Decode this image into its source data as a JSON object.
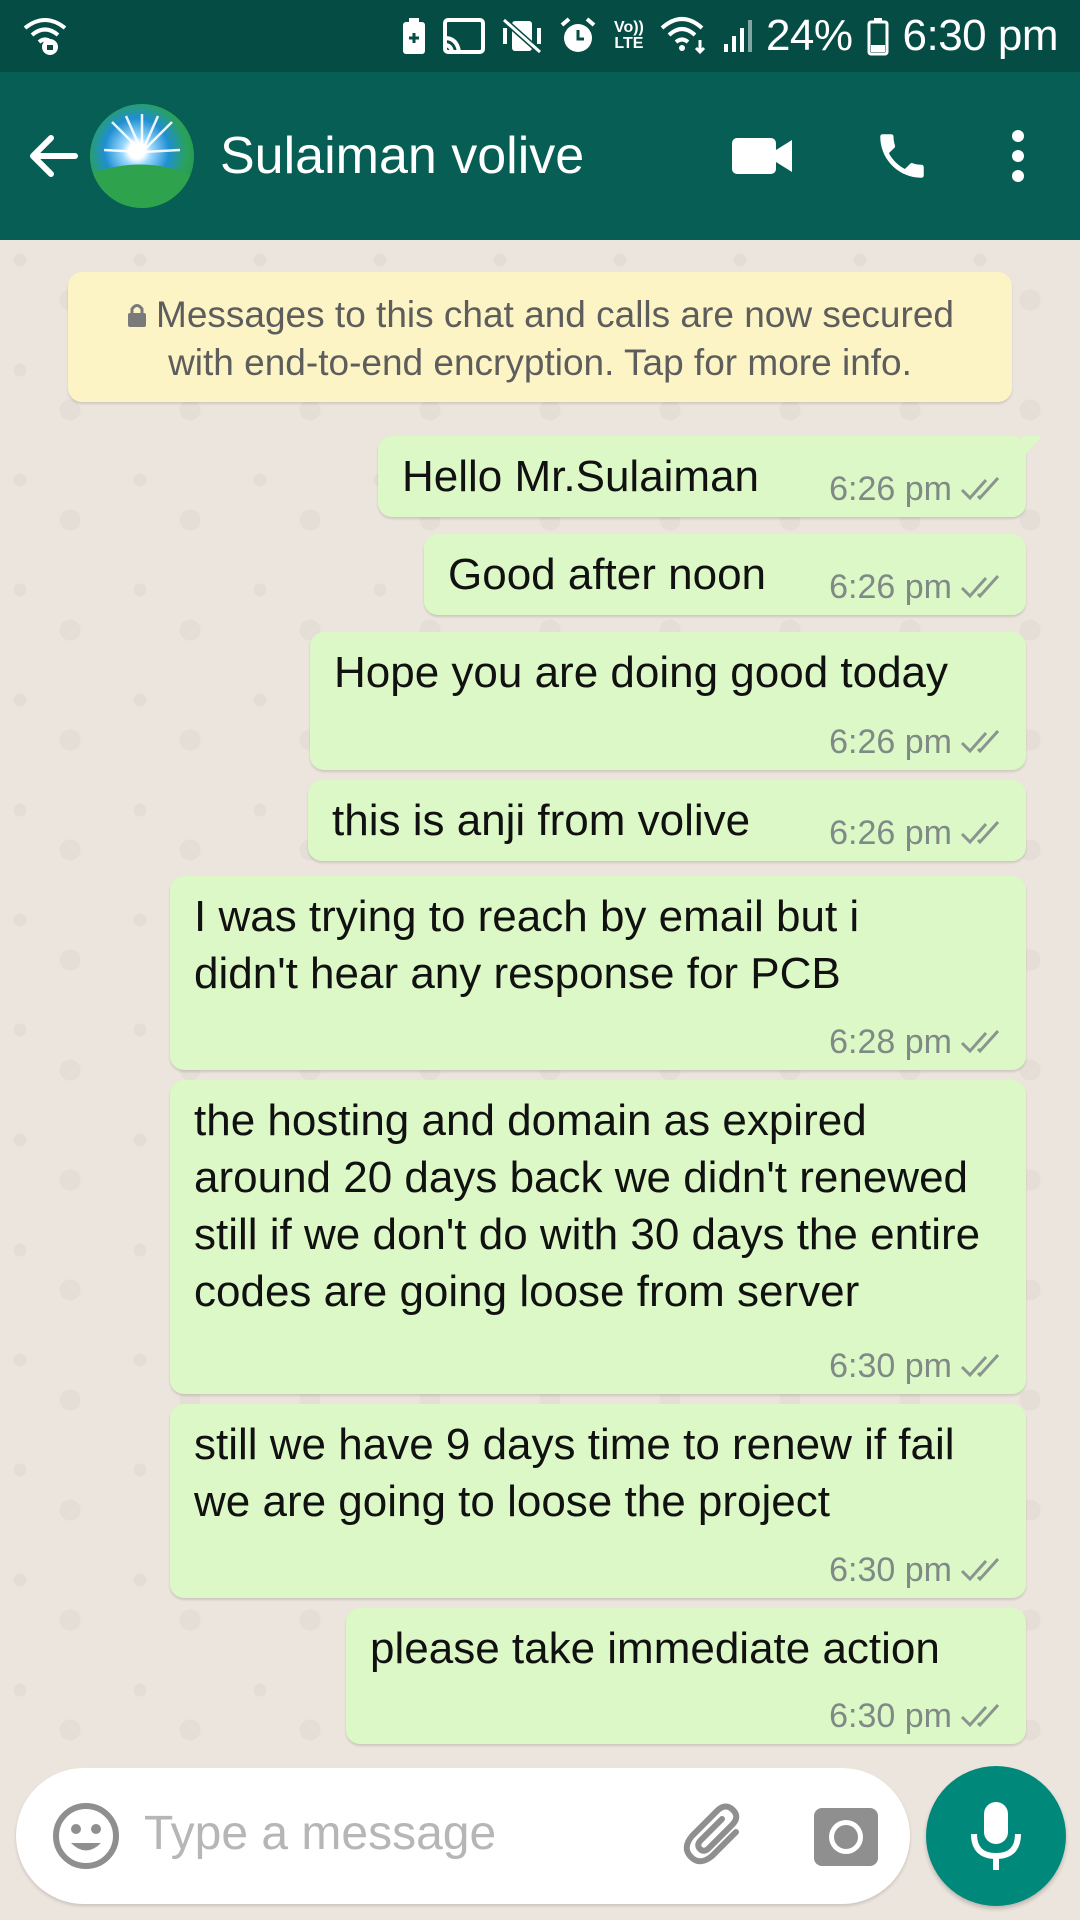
{
  "status_bar": {
    "battery": "24%",
    "time": "6:30 pm",
    "volte": "Vo)) LTE"
  },
  "header": {
    "contact_name": "Sulaiman volive"
  },
  "encryption_notice": "Messages to this chat and calls are now secured with end-to-end encryption. Tap for more info.",
  "messages": [
    {
      "text": "Hello Mr.Sulaiman",
      "time": "6:26 pm"
    },
    {
      "text": "Good after noon",
      "time": "6:26 pm"
    },
    {
      "text": "Hope you are doing good today",
      "time": "6:26 pm"
    },
    {
      "text": "this is anji from volive",
      "time": "6:26 pm"
    },
    {
      "text": "I was trying to reach by email but i didn't hear any response for PCB",
      "time": "6:28 pm"
    },
    {
      "text": "the hosting and domain as expired around 20 days back we didn't renewed still if we don't do with 30 days the entire codes are going loose from server",
      "time": "6:30 pm"
    },
    {
      "text": "still we have 9 days time to renew if fail we are going to loose the project",
      "time": "6:30 pm"
    },
    {
      "text": "please take immediate action",
      "time": "6:30 pm"
    }
  ],
  "composer": {
    "placeholder": "Type a message"
  },
  "colors": {
    "header": "#075e54",
    "status_bar": "#054d44",
    "outgoing_bubble": "#dcf8c6",
    "notice": "#fcf4c4",
    "mic_button": "#00897b"
  }
}
